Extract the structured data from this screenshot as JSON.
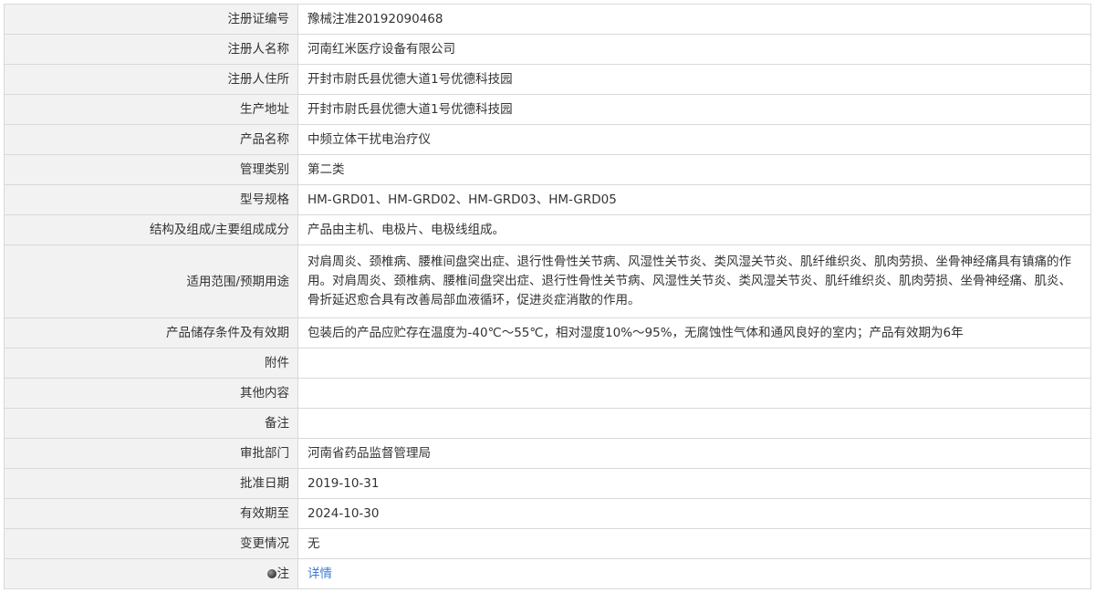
{
  "rows": [
    {
      "label": "注册证编号",
      "value": "豫械注准20192090468"
    },
    {
      "label": "注册人名称",
      "value": "河南红米医疗设备有限公司"
    },
    {
      "label": "注册人住所",
      "value": "开封市尉氏县优德大道1号优德科技园"
    },
    {
      "label": "生产地址",
      "value": "开封市尉氏县优德大道1号优德科技园"
    },
    {
      "label": "产品名称",
      "value": "中频立体干扰电治疗仪"
    },
    {
      "label": "管理类别",
      "value": "第二类"
    },
    {
      "label": "型号规格",
      "value": "HM-GRD01、HM-GRD02、HM-GRD03、HM-GRD05"
    },
    {
      "label": "结构及组成/主要组成成分",
      "value": "产品由主机、电极片、电极线组成。"
    },
    {
      "label": "适用范围/预期用途",
      "value": "对肩周炎、颈椎病、腰椎间盘突出症、退行性骨性关节病、风湿性关节炎、类风湿关节炎、肌纤维织炎、肌肉劳损、坐骨神经痛具有镇痛的作用。对肩周炎、颈椎病、腰椎间盘突出症、退行性骨性关节病、风湿性关节炎、类风湿关节炎、肌纤维织炎、肌肉劳损、坐骨神经痛、肌炎、骨折延迟愈合具有改善局部血液循环，促进炎症消散的作用。"
    },
    {
      "label": "产品储存条件及有效期",
      "value": "包装后的产品应贮存在温度为-40℃～55℃，相对湿度10%～95%，无腐蚀性气体和通风良好的室内；产品有效期为6年"
    },
    {
      "label": "附件",
      "value": ""
    },
    {
      "label": "其他内容",
      "value": ""
    },
    {
      "label": "备注",
      "value": ""
    },
    {
      "label": "审批部门",
      "value": "河南省药品监督管理局"
    },
    {
      "label": "批准日期",
      "value": "2019-10-31"
    },
    {
      "label": "有效期至",
      "value": "2024-10-30"
    },
    {
      "label": "变更情况",
      "value": "无"
    }
  ],
  "note": {
    "label": "注",
    "icon": "info-dot-icon",
    "link_text": "详情",
    "link_color": "#3a7bd5"
  }
}
